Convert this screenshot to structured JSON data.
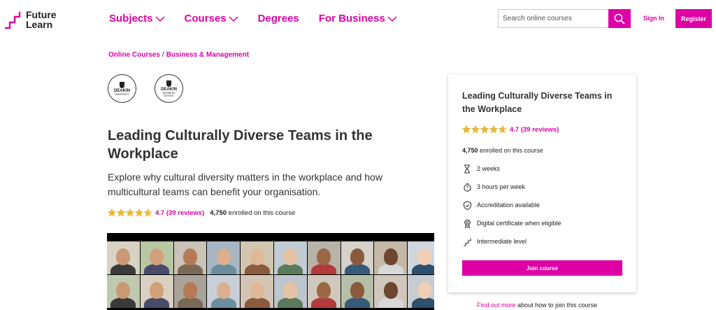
{
  "header": {
    "logo": {
      "line1": "Future",
      "line2": "Learn"
    },
    "nav": [
      {
        "label": "Subjects",
        "has_dropdown": true
      },
      {
        "label": "Courses",
        "has_dropdown": true
      },
      {
        "label": "Degrees",
        "has_dropdown": false
      },
      {
        "label": "For Business",
        "has_dropdown": true
      }
    ],
    "search": {
      "placeholder": "Search online courses",
      "value": ""
    },
    "sign_in": "Sign In",
    "register": "Register"
  },
  "breadcrumb": [
    {
      "label": "Online Courses"
    },
    {
      "label": "Business & Management"
    }
  ],
  "partners": [
    {
      "name": "DEAKIN",
      "sub": "UNIVERSITY"
    },
    {
      "name": "DEAKIN",
      "sub": "BUSINESS SCHOOL"
    }
  ],
  "course": {
    "title": "Leading Culturally Diverse Teams in the Workplace",
    "description": "Explore why cultural diversity matters in the workplace and how multicultural teams can benefit your organisation.",
    "rating": "4.7 (39 reviews)",
    "rating_value": 4.7,
    "enrolled_count": "4,750",
    "enrolled_suffix": "enrolled on this course"
  },
  "sidebar": {
    "title": "Leading Culturally Diverse Teams in the Workplace",
    "rating": "4.7 (39 reviews)",
    "enrolled_count": "4,750",
    "enrolled_suffix": "enrolled on this course",
    "features": [
      {
        "icon": "hourglass-icon",
        "label": "2 weeks"
      },
      {
        "icon": "stopwatch-icon",
        "label": "3 hours per week"
      },
      {
        "icon": "shield-check-icon",
        "label": "Accreditation available"
      },
      {
        "icon": "certificate-icon",
        "label": "Digital certificate when eligible"
      },
      {
        "icon": "steps-icon",
        "label": "Intermediate level"
      }
    ],
    "join_button": "Join course",
    "find_out_link": "Find out more",
    "find_out_suffix": "about how to join this course"
  },
  "colors": {
    "brand": "#de00a5",
    "star": "#e8b83a",
    "text": "#222222"
  }
}
